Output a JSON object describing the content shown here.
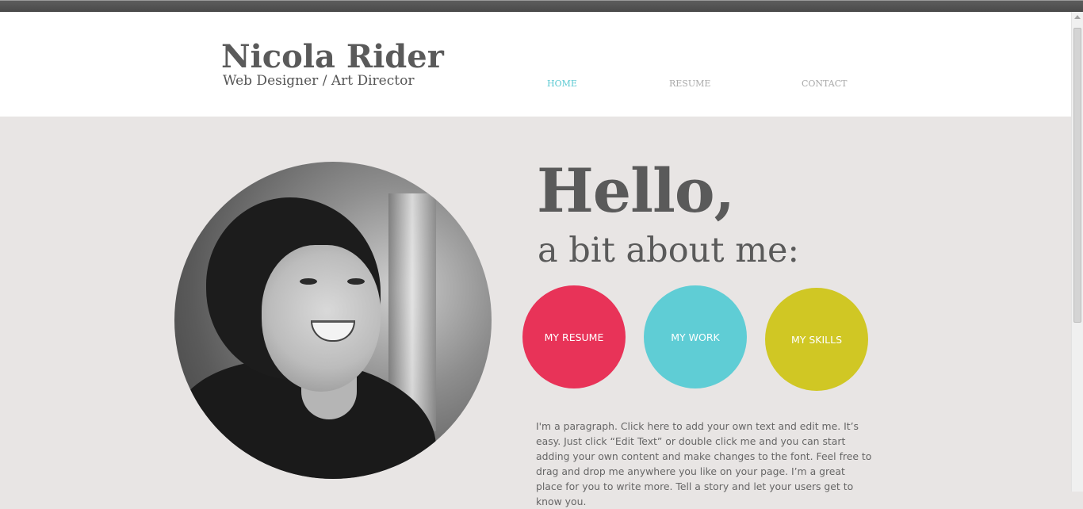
{
  "header": {
    "site_title": "Nicola Rider",
    "site_subtitle": "Web Designer / Art Director"
  },
  "nav": {
    "items": [
      {
        "label": "HOME",
        "active": true
      },
      {
        "label": "RESUME",
        "active": false
      },
      {
        "label": "CONTACT",
        "active": false
      }
    ]
  },
  "hero": {
    "heading": "Hello,",
    "subheading": "a bit about me:",
    "portrait_alt": "black and white portrait photo of a smiling woman"
  },
  "circle_buttons": [
    {
      "label": "MY RESUME",
      "color": "#e83358"
    },
    {
      "label": "MY WORK",
      "color": "#5fcdd5"
    },
    {
      "label": "MY SKILLS",
      "color": "#d0c724"
    }
  ],
  "intro": {
    "paragraph": "I'm a paragraph. Click here to add your own text and edit me. It’s easy. Just click “Edit Text” or double click me and you can start adding your own content and make changes to the font. Feel free to drag and drop me anywhere you like on your page. I’m a great place for you to write more. Tell a story and let your users get to know you."
  },
  "colors": {
    "accent_active_nav": "#5bc9d2",
    "page_background": "#e8e5e4",
    "heading_text": "#5a5a5a"
  }
}
